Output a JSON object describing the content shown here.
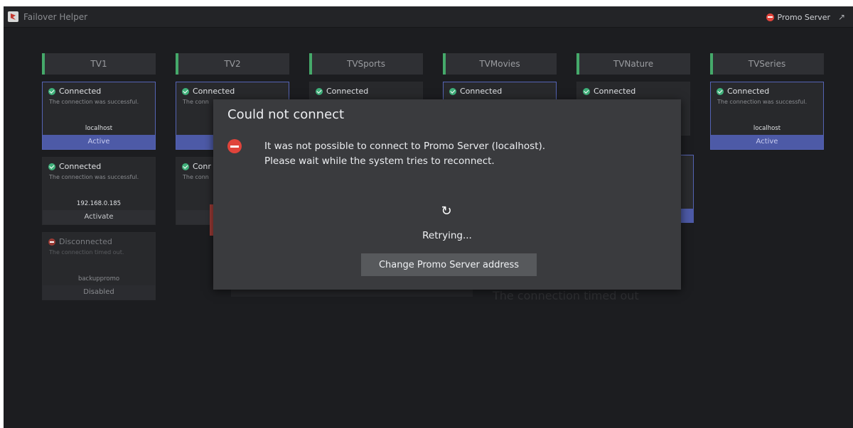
{
  "app": {
    "title": "Failover Helper",
    "server_label": "Promo Server"
  },
  "columns": [
    {
      "name": "TV1",
      "cards": [
        {
          "state": "Connected",
          "message": "The connection was successful.",
          "host": "localhost",
          "action": "Active",
          "status": "ok",
          "kind": "active"
        },
        {
          "state": "Connected",
          "message": "The connection was successful.",
          "host": "192.168.0.185",
          "action": "Activate",
          "status": "ok",
          "kind": "normal"
        },
        {
          "state": "Disconnected",
          "message": "The connection timed out.",
          "host": "backuppromo",
          "action": "Disabled",
          "status": "err",
          "kind": "dim"
        }
      ]
    },
    {
      "name": "TV2",
      "cards": [
        {
          "state": "Connected",
          "message": "The conn",
          "kind": "active",
          "status": "ok"
        },
        {
          "state": "Conr",
          "message": "The conn",
          "kind": "normal",
          "status": "ok"
        }
      ]
    },
    {
      "name": "TVSports",
      "cards": [
        {
          "state": "Connected",
          "status": "ok"
        }
      ]
    },
    {
      "name": "TVMovies",
      "cards": [
        {
          "state": "Connected",
          "status": "ok"
        }
      ]
    },
    {
      "name": "TVNature",
      "cards": [
        {
          "state": "Connected",
          "status": "ok"
        }
      ]
    },
    {
      "name": "TVSeries",
      "cards": [
        {
          "state": "Connected",
          "message": "The connection was successful.",
          "host": "localhost",
          "action": "Active",
          "status": "ok",
          "kind": "active"
        }
      ]
    }
  ],
  "background_text": "The connection timed out",
  "dialog": {
    "title": "Could not connect",
    "message_line1": "It was not possible to connect to Promo Server (localhost).",
    "message_line2": "Please wait while the system tries to reconnect.",
    "retry_text": "Retrying...",
    "change_button": "Change Promo Server address"
  },
  "colors": {
    "accent_green": "#45a96a",
    "active_blue": "#4d5aa7",
    "error_red": "#e0443b",
    "ok_green": "#3fb07a"
  }
}
